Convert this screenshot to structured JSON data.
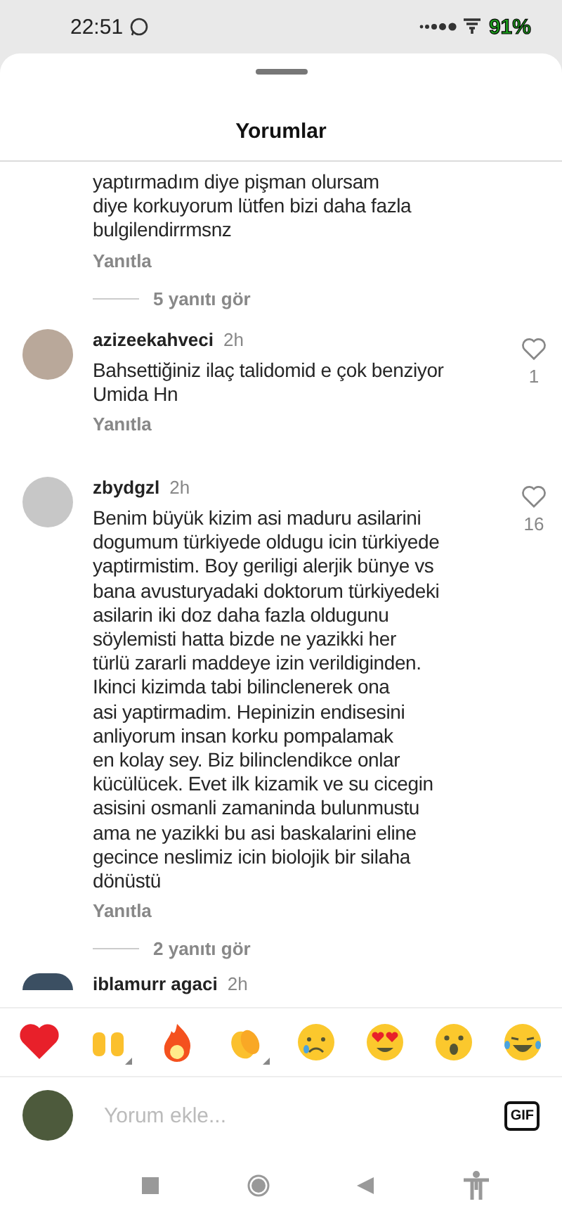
{
  "status_bar": {
    "time": "22:51",
    "battery": "91%"
  },
  "sheet": {
    "title": "Yorumlar"
  },
  "comments": [
    {
      "kind": "partial",
      "text": "yaptırmadım diye pişman olursam\ndiye korkuyorum lütfen bizi daha fazla\nbulgilendirrmsnz",
      "reply": "Yanıtla",
      "view_replies": "5 yanıtı gör"
    },
    {
      "kind": "full",
      "username": "azizeekahveci",
      "time": "2h",
      "text": "Bahsettiğiniz ilaç talidomid e çok benziyor\nUmida Hn",
      "reply": "Yanıtla",
      "likes": "1"
    },
    {
      "kind": "full",
      "username": "zbydgzl",
      "time": "2h",
      "text": "Benim büyük kizim asi maduru asilarini\ndogumum türkiyede oldugu icin türkiyede\nyaptirmistim. Boy geriligi alerjik bünye vs\nbana avusturyadaki doktorum türkiyedeki\nasilarin iki doz daha fazla oldugunu\nsöylemisti hatta bizde ne yazikki her\ntürlü zararli maddeye izin verildiginden.\nIkinci kizimda tabi bilinclenerek ona\nasi yaptirmadim. Hepinizin endisesini\nanliyorum insan korku pompalamak\nen kolay sey. Biz bilinclendikce onlar\nkücülücek. Evet ilk kizamik ve su cicegin\nasisini osmanli zamaninda bulunmustu\nama ne yazikki bu asi baskalarini eline\ngecince neslimiz icin biolojik bir silaha\ndönüstü",
      "reply": "Yanıtla",
      "likes": "16",
      "view_replies": "2 yanıtı gör"
    },
    {
      "kind": "header",
      "username": "iblamurr agaci",
      "time": "2h"
    }
  ],
  "composer": {
    "placeholder": "Yorum ekle...",
    "gif": "GIF"
  }
}
